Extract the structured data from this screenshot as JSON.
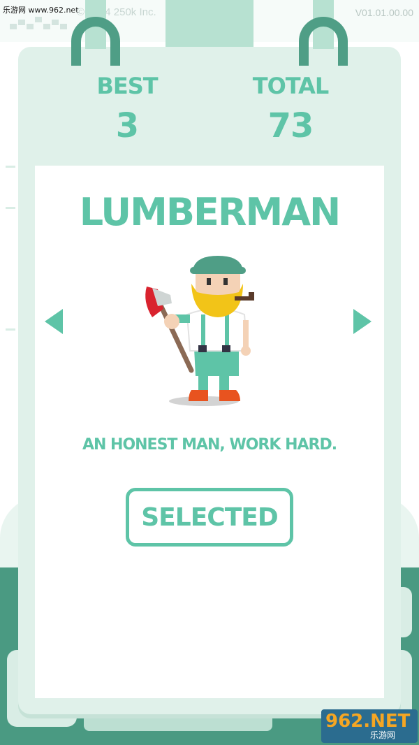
{
  "watermark": "乐游网 www.962.net",
  "copyright": "© 2014 250k Inc.",
  "version": "V01.01.00.00",
  "stats": {
    "best_label": "BEST",
    "best_value": "3",
    "total_label": "TOTAL",
    "total_value": "73"
  },
  "character": {
    "name": "LUMBERMAN",
    "description": "AN HONEST MAN, WORK HARD.",
    "button_label": "SELECTED"
  },
  "badge": {
    "number": "962.NET",
    "site": "乐游网"
  },
  "colors": {
    "accent": "#5ec4a7",
    "card": "#e0f1ea",
    "ground": "#4a9a82",
    "hook": "#4f9e86"
  }
}
